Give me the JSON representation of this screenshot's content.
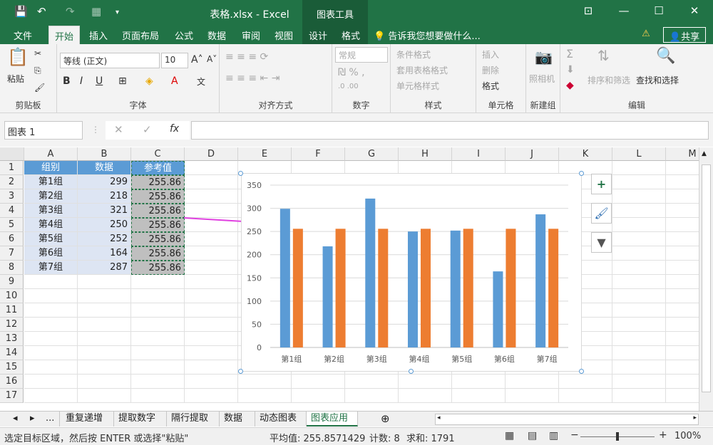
{
  "window": {
    "title": "表格.xlsx - Excel",
    "context_tab_group": "图表工具"
  },
  "ribbon_tabs": [
    "文件",
    "开始",
    "插入",
    "页面布局",
    "公式",
    "数据",
    "审阅",
    "视图",
    "设计",
    "格式"
  ],
  "tell_me": "告诉我您想要做什么...",
  "share_label": "共享",
  "font": {
    "name": "等线 (正文)",
    "size": "10"
  },
  "ribbon_groups": {
    "clipboard": "剪贴板",
    "font": "字体",
    "alignment": "对齐方式",
    "number": "数字",
    "styles": "样式",
    "cells": "单元格",
    "new_group": "新建组",
    "editing": "编辑"
  },
  "ribbon_items": {
    "paste": "粘贴",
    "number_format": "常规",
    "conditional_formatting": "条件格式",
    "format_as_table": "套用表格格式",
    "cell_styles": "单元格样式",
    "insert": "插入",
    "delete": "删除",
    "format": "格式",
    "camera": "照相机",
    "sort_filter": "排序和筛选",
    "find_select": "查找和选择"
  },
  "formula_bar": {
    "name_box": "图表 1",
    "fx": "fx",
    "content": ""
  },
  "columns": [
    "A",
    "B",
    "C",
    "D",
    "E",
    "F",
    "G",
    "H",
    "I",
    "J",
    "K",
    "L",
    "M"
  ],
  "rows": [
    "1",
    "2",
    "3",
    "4",
    "5",
    "6",
    "7",
    "8",
    "9",
    "10",
    "11",
    "12",
    "13",
    "14",
    "15",
    "16",
    "17"
  ],
  "table": {
    "headers": [
      "组别",
      "数据",
      "参考值"
    ],
    "rows": [
      [
        "第1组",
        "299",
        "255.86"
      ],
      [
        "第2组",
        "218",
        "255.86"
      ],
      [
        "第3组",
        "321",
        "255.86"
      ],
      [
        "第4组",
        "250",
        "255.86"
      ],
      [
        "第5组",
        "252",
        "255.86"
      ],
      [
        "第6组",
        "164",
        "255.86"
      ],
      [
        "第7组",
        "287",
        "255.86"
      ]
    ]
  },
  "chart_data": {
    "type": "bar",
    "categories": [
      "第1组",
      "第2组",
      "第3组",
      "第4组",
      "第5组",
      "第6组",
      "第7组"
    ],
    "series": [
      {
        "values": [
          299,
          218,
          321,
          250,
          252,
          164,
          287
        ],
        "color": "#5b9bd5"
      },
      {
        "values": [
          255.86,
          255.86,
          255.86,
          255.86,
          255.86,
          255.86,
          255.86
        ],
        "color": "#ed7d31"
      }
    ],
    "yticks": [
      "0",
      "50",
      "100",
      "150",
      "200",
      "250",
      "300",
      "350"
    ],
    "ylim": [
      0,
      350
    ],
    "grid": true
  },
  "chart_buttons": {
    "add": "+",
    "style": "🖌",
    "filter": "▼"
  },
  "sheet_tabs": [
    "...",
    "重复递增",
    "提取数字",
    "隔行提取",
    "数据",
    "动态图表",
    "图表应用"
  ],
  "active_sheet": "图表应用",
  "status": {
    "message": "选定目标区域，然后按 ENTER 或选择\"粘贴\"",
    "average": "平均值: 255.8571429",
    "count": "计数: 8",
    "sum": "求和: 1791",
    "zoom": "100%"
  },
  "colors": {
    "excel_green": "#217346",
    "header_fill": "#5b9bd5",
    "accent_pink": "#e040e0"
  }
}
